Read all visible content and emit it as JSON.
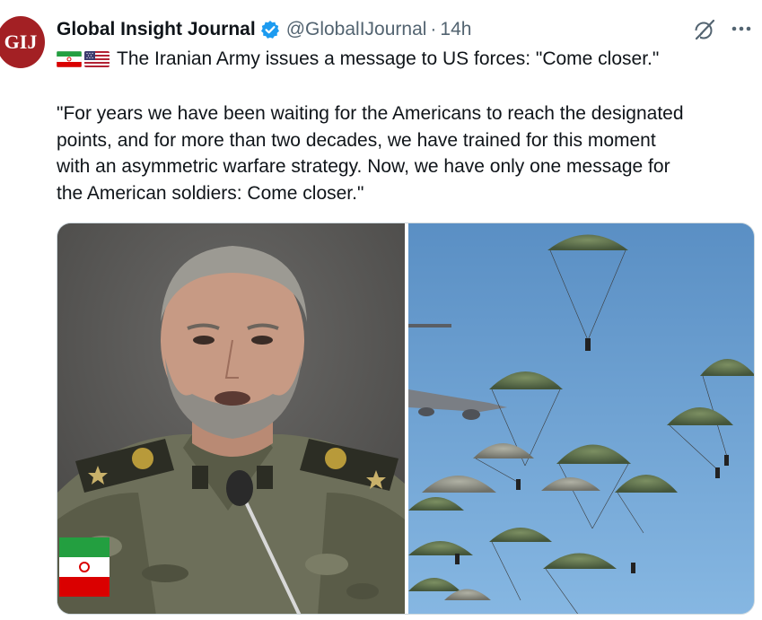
{
  "tweet": {
    "avatar_text": "GIJ",
    "display_name": "Global Insight Journal",
    "handle": "@GlobalIJournal",
    "separator": "·",
    "time": "14h",
    "lead_text": "The Iranian Army issues a message to US forces: \"Come closer.\"",
    "body_lines": [
      "\"For years we have been waiting for the Americans to reach the designated",
      "points, and for more than two decades, we have trained for this moment",
      "with an asymmetric warfare strategy. Now, we have only one message for",
      "the American soldiers: Come closer.\""
    ]
  },
  "icons": {
    "verified": "verified-badge-icon",
    "grok": "grok-icon",
    "more": "more-options-icon",
    "flag1": "iran-flag-icon",
    "flag2": "us-flag-icon"
  },
  "colors": {
    "verified_blue": "#1d9bf0",
    "avatar_red": "#a32024",
    "secondary_text": "#536471",
    "primary_text": "#0f1419",
    "card_border": "#cfd9de"
  },
  "media": {
    "left_image": "Iranian military commander speaking at a microphone",
    "right_image": "Paratroopers descending under green parachutes from aircraft"
  }
}
